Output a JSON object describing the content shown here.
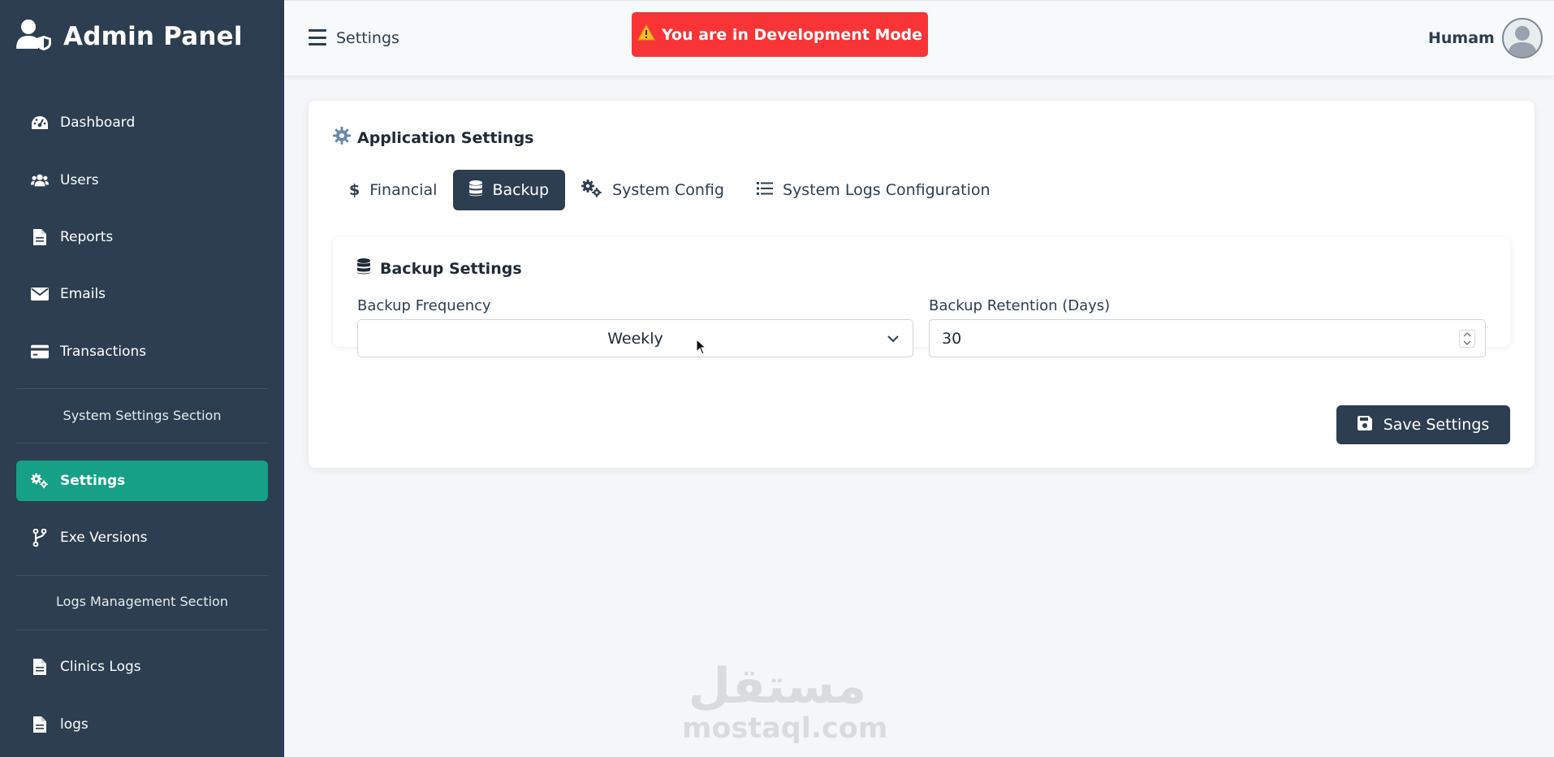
{
  "brand": {
    "title": "Admin Panel"
  },
  "sidebar": {
    "items": [
      {
        "label": "Dashboard",
        "icon": "dashboard-icon"
      },
      {
        "label": "Users",
        "icon": "users-icon"
      },
      {
        "label": "Reports",
        "icon": "file-icon"
      },
      {
        "label": "Emails",
        "icon": "envelope-icon"
      },
      {
        "label": "Transactions",
        "icon": "credit-card-icon"
      },
      {
        "label": "Settings",
        "icon": "gears-icon",
        "active": true
      },
      {
        "label": "Exe Versions",
        "icon": "branch-icon"
      },
      {
        "label": "Clinics Logs",
        "icon": "file-icon"
      },
      {
        "label": "logs",
        "icon": "file-icon"
      }
    ],
    "sections": {
      "system": "System Settings Section",
      "logs": "Logs Management Section"
    }
  },
  "topbar": {
    "title": "Settings",
    "dev_mode": "You are in Development Mode",
    "username": "Humam"
  },
  "card": {
    "title": "Application Settings",
    "tabs": [
      {
        "label": "Financial",
        "icon": "dollar-icon"
      },
      {
        "label": "Backup",
        "icon": "database-icon",
        "active": true
      },
      {
        "label": "System Config",
        "icon": "gears-icon"
      },
      {
        "label": "System Logs Configuration",
        "icon": "list-icon"
      }
    ],
    "backup": {
      "title": "Backup Settings",
      "frequency_label": "Backup Frequency",
      "frequency_value": "Weekly",
      "retention_label": "Backup Retention (Days)",
      "retention_value": "30"
    },
    "save_label": "Save Settings"
  },
  "watermark": {
    "arabic": "مستقل",
    "latin": "mostaql.com"
  },
  "colors": {
    "sidebar": "#2c3e50",
    "active": "#16a085",
    "danger": "#f93436",
    "primary": "#2c3e50"
  }
}
